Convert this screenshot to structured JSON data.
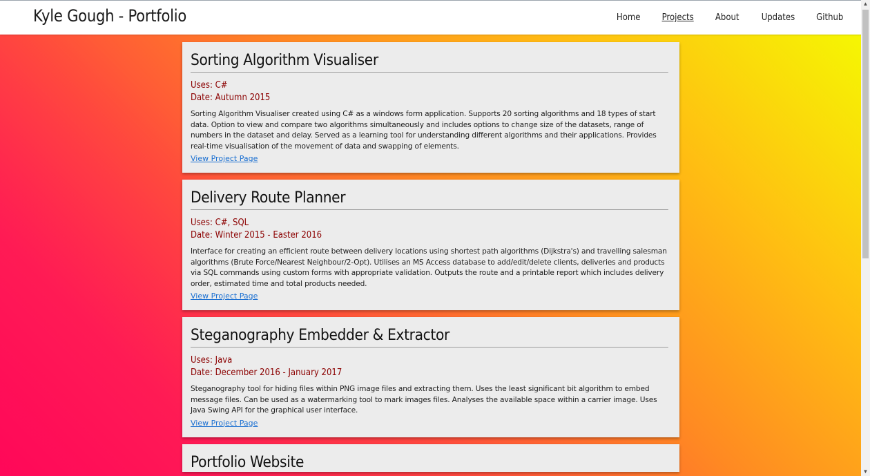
{
  "header": {
    "brand": "Kyle Gough - Portfolio",
    "nav": [
      {
        "label": "Home",
        "active": false
      },
      {
        "label": "Projects",
        "active": true
      },
      {
        "label": "About",
        "active": false
      },
      {
        "label": "Updates",
        "active": false
      },
      {
        "label": "Github",
        "active": false
      }
    ]
  },
  "projects": [
    {
      "title": "Sorting Algorithm Visualiser",
      "uses": "Uses: C#",
      "date": "Date: Autumn 2015",
      "description": "Sorting Algorithm Visualiser created using C# as a windows form application. Supports 20 sorting algorithms and 18 types of start data. Option to view and compare two algorithms simultaneously and includes options to change size of the datasets, range of numbers in the dataset and delay. Served as a learning tool for understanding different algorithms and their applications. Provides real-time visualisation of the movement of data and swapping of elements.",
      "link": "View Project Page"
    },
    {
      "title": "Delivery Route Planner",
      "uses": "Uses: C#, SQL",
      "date": "Date: Winter 2015 - Easter 2016",
      "description": "Interface for creating an efficient route between delivery locations using shortest path algorithms (Dijkstra's) and travelling salesman algorithms (Brute Force/Nearest Neighbour/2-Opt). Utilises an MS Access database to add/edit/delete clients, deliveries and products via SQL commands using custom forms with appropriate validation. Outputs the route and a printable report which includes delivery order, estimated time and total products needed.",
      "link": "View Project Page"
    },
    {
      "title": "Steganography Embedder & Extractor",
      "uses": "Uses: Java",
      "date": "Date: December 2016 - January 2017",
      "description": "Steganography tool for hiding files within PNG image files and extracting them. Uses the least significant bit algorithm to embed message files. Can be used as a watermarking tool to mark images files. Analyses the available space within a carrier image. Uses Java Swing API for the graphical user interface.",
      "link": "View Project Page"
    },
    {
      "title": "Portfolio Website"
    }
  ]
}
